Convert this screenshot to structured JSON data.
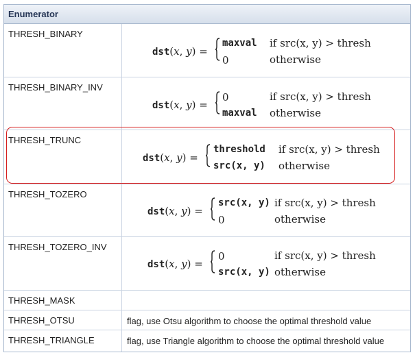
{
  "table": {
    "header": "Enumerator",
    "rows": [
      {
        "name": "THRESH_BINARY",
        "formula": {
          "lhs": "dst(x, y)",
          "cases": [
            {
              "expr": "maxval",
              "cond": "if src(x, y) > thresh"
            },
            {
              "expr": "0",
              "cond": "otherwise"
            }
          ]
        }
      },
      {
        "name": "THRESH_BINARY_INV",
        "formula": {
          "lhs": "dst(x, y)",
          "cases": [
            {
              "expr": "0",
              "cond": "if src(x, y) > thresh"
            },
            {
              "expr": "maxval",
              "cond": "otherwise"
            }
          ]
        }
      },
      {
        "name": "THRESH_TRUNC",
        "formula": {
          "lhs": "dst(x, y)",
          "cases": [
            {
              "expr": "threshold",
              "cond": "if src(x, y) > thresh"
            },
            {
              "expr": "src(x, y)",
              "cond": "otherwise"
            }
          ]
        }
      },
      {
        "name": "THRESH_TOZERO",
        "formula": {
          "lhs": "dst(x, y)",
          "cases": [
            {
              "expr": "src(x, y)",
              "cond": "if src(x, y) > thresh"
            },
            {
              "expr": "0",
              "cond": "otherwise"
            }
          ]
        }
      },
      {
        "name": "THRESH_TOZERO_INV",
        "formula": {
          "lhs": "dst(x, y)",
          "cases": [
            {
              "expr": "0",
              "cond": "if src(x, y) > thresh"
            },
            {
              "expr": "src(x, y)",
              "cond": "otherwise"
            }
          ]
        }
      },
      {
        "name": "THRESH_MASK",
        "description": ""
      },
      {
        "name": "THRESH_OTSU",
        "description": "flag, use Otsu algorithm to choose the optimal threshold value"
      },
      {
        "name": "THRESH_TRIANGLE",
        "description": "flag, use Triangle algorithm to choose the optimal threshold value"
      }
    ]
  },
  "highlight_color": "#d62020",
  "border_color": "#a9b9cf"
}
